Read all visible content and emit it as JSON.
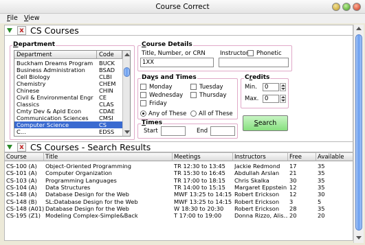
{
  "window": {
    "title": "Course Correct"
  },
  "menu": [
    {
      "label": "File",
      "accel": "F",
      "rest": "ile"
    },
    {
      "label": "View",
      "accel": "V",
      "rest": "iew"
    }
  ],
  "filters": {
    "section_title": "CS Courses",
    "department": {
      "legend_accel": "D",
      "legend_rest": "epartment",
      "columns": [
        "Department",
        "Code"
      ],
      "rows": [
        {
          "name": "Buckham Dreams Program",
          "code": "BUCK"
        },
        {
          "name": "Business Administration",
          "code": "BSAD"
        },
        {
          "name": "Cell Biology",
          "code": "CLBI"
        },
        {
          "name": "Chemistry",
          "code": "CHEM"
        },
        {
          "name": "Chinese",
          "code": "CHIN"
        },
        {
          "name": "Civil & Environmental Engr",
          "code": "CE"
        },
        {
          "name": "Classics",
          "code": "CLAS"
        },
        {
          "name": "Cmty Dev & Apld Econ",
          "code": "CDAE"
        },
        {
          "name": "Communication Sciences",
          "code": "CMSI"
        },
        {
          "name": "Computer Science",
          "code": "CS"
        },
        {
          "name": "C...",
          "code": "EDSS"
        }
      ],
      "selected_index": 9
    },
    "course_details": {
      "legend_accel": "C",
      "legend_rest": "ourse Details",
      "title_label": "Title, Number, or CRN",
      "title_value": "1XX",
      "instructor_label": "Instructor",
      "instructor_value": "",
      "phonetic_label": "Phonetic",
      "phonetic_checked": false
    },
    "days_times": {
      "legend_accel": "y",
      "legend_pre": "Da",
      "legend_rest": "s and Times",
      "days": [
        {
          "label": "Monday",
          "checked": false
        },
        {
          "label": "Tuesday",
          "checked": false
        },
        {
          "label": "Wednesday",
          "checked": false
        },
        {
          "label": "Thursday",
          "checked": false
        },
        {
          "label": "Friday",
          "checked": false
        }
      ],
      "match_any": "Any of These",
      "match_all": "All of These",
      "selected_match": "any"
    },
    "credits": {
      "legend_accel": "r",
      "legend_pre": "C",
      "legend_rest": "edits",
      "min_label": "Min.",
      "min_value": "0",
      "max_label": "Max.",
      "max_value": "0"
    },
    "times": {
      "legend_accel": "T",
      "legend_rest": "imes",
      "start_label": "Start",
      "start_value": "",
      "end_label": "End",
      "end_value": ""
    },
    "search_label_accel": "S",
    "search_label_rest": "earch"
  },
  "results": {
    "section_title": "CS Courses - Search Results",
    "columns": [
      "Course",
      "Title",
      "Meetings",
      "Instructors",
      "Free",
      "Available"
    ],
    "rows": [
      {
        "course": "CS-100 (A)",
        "title": "Object-Oriented Programming",
        "meetings": "TR 12:30 to 13:45",
        "instructors": "Jackie Redmond",
        "free": "17",
        "available": "35"
      },
      {
        "course": "CS-101 (A)",
        "title": "Computer Organization",
        "meetings": "TR 15:30 to 16:45",
        "instructors": "Abdullah Arslan",
        "free": "21",
        "available": "35"
      },
      {
        "course": "CS-103 (A)",
        "title": "Programming Languages",
        "meetings": "TR 17:00 to 18:15",
        "instructors": "Chris Skalka",
        "free": "30",
        "available": "35"
      },
      {
        "course": "CS-104 (A)",
        "title": "Data Structures",
        "meetings": "TR 14:00 to 15:15",
        "instructors": "Margaret Eppstein",
        "free": "12",
        "available": "35"
      },
      {
        "course": "CS-148 (A)",
        "title": "Database Design for the Web",
        "meetings": "MWF 13:25 to 14:15",
        "instructors": "Robert Erickson",
        "free": "12",
        "available": "30"
      },
      {
        "course": "CS-148 (B)",
        "title": "SL:Database Design for the Web",
        "meetings": "MWF 13:25 to 14:15",
        "instructors": "Robert Erickson",
        "free": "3",
        "available": "5"
      },
      {
        "course": "CS-148 (A01)",
        "title": "Database Design for the Web",
        "meetings": "W 18:30 to 20:30",
        "instructors": "Robert Erickson",
        "free": "28",
        "available": "35"
      },
      {
        "course": "CS-195 (Z1)",
        "title": "Modeling Complex-Simple&Back",
        "meetings": "T 17:00 to 19:00",
        "instructors": "Donna Rizzo, Alis...",
        "free": "20",
        "available": "20"
      }
    ]
  }
}
